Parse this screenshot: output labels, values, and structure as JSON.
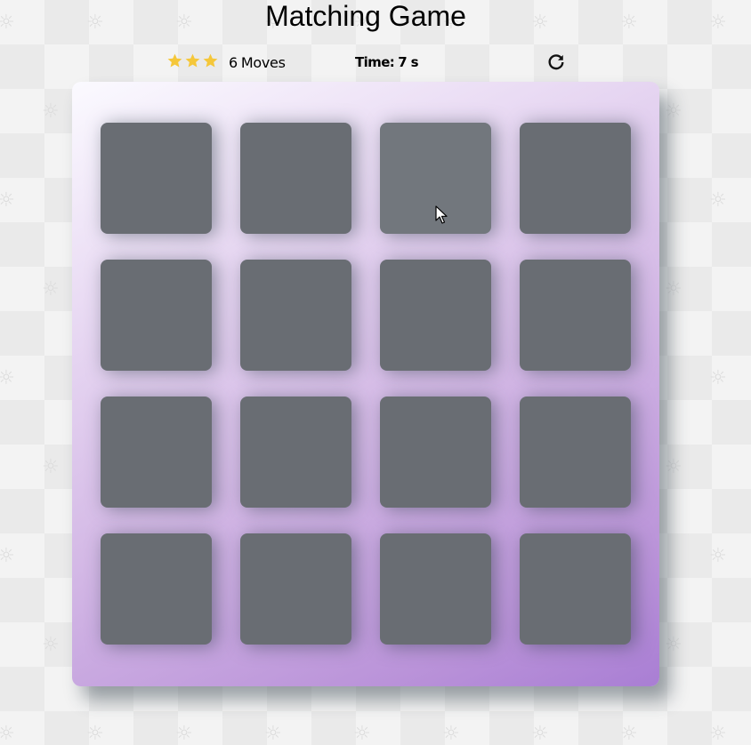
{
  "title": "Matching Game",
  "score_panel": {
    "stars": [
      {
        "icon": "star-icon",
        "color": "#f5c73a"
      },
      {
        "icon": "star-icon",
        "color": "#f5c73a"
      },
      {
        "icon": "star-icon",
        "color": "#f5c73a"
      }
    ],
    "moves_count": "6",
    "moves_label": "Moves",
    "timer_label": "Time:",
    "timer_value": "7 s",
    "restart_icon": "restart-icon"
  },
  "deck": {
    "rows": 4,
    "columns": 4,
    "cards": [
      {
        "state": "face-down"
      },
      {
        "state": "face-down"
      },
      {
        "state": "face-down",
        "hovered": true
      },
      {
        "state": "face-down"
      },
      {
        "state": "face-down"
      },
      {
        "state": "face-down"
      },
      {
        "state": "face-down"
      },
      {
        "state": "face-down"
      },
      {
        "state": "face-down"
      },
      {
        "state": "face-down"
      },
      {
        "state": "face-down"
      },
      {
        "state": "face-down"
      },
      {
        "state": "face-down"
      },
      {
        "state": "face-down"
      },
      {
        "state": "face-down"
      },
      {
        "state": "face-down"
      }
    ]
  },
  "colors": {
    "card_back": "#696d73",
    "star": "#f5c73a",
    "deck_gradient_start": "#fbfaff",
    "deck_gradient_end": "#a97ed4"
  }
}
